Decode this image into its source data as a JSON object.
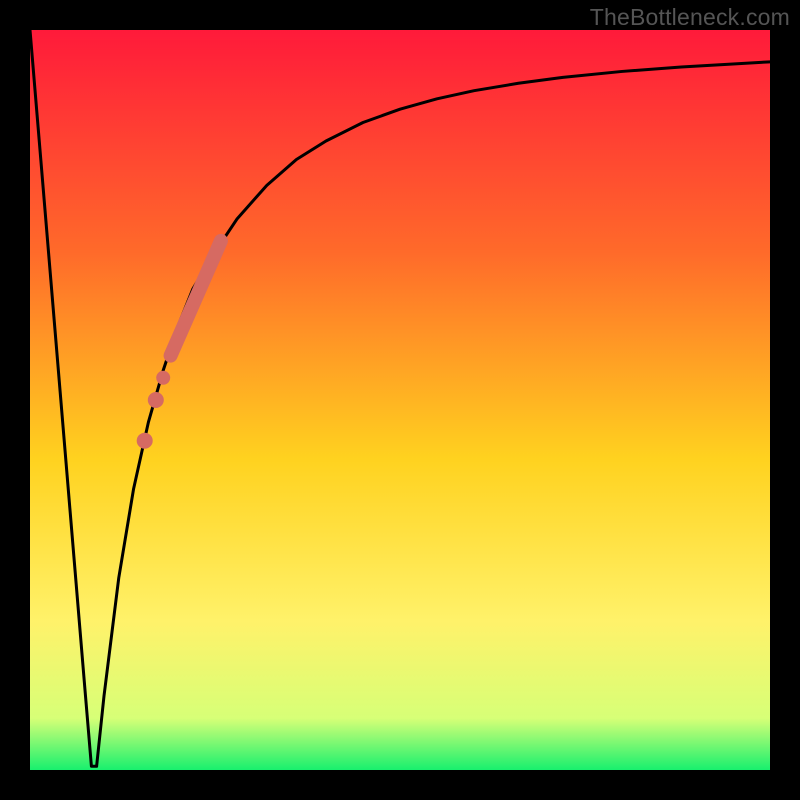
{
  "watermark": "TheBottleneck.com",
  "colors": {
    "frame": "#000000",
    "gradient_top": "#ff1a3a",
    "gradient_upper": "#ff6a2a",
    "gradient_mid": "#ffd21f",
    "gradient_lower": "#fff26a",
    "gradient_band": "#d7ff77",
    "gradient_bottom": "#18f06e",
    "curve": "#000000",
    "dot_fill": "#d66a62",
    "dot_stroke": "#b34f49"
  },
  "chart_data": {
    "type": "line",
    "title": "",
    "xlabel": "",
    "ylabel": "",
    "xlim": [
      0,
      100
    ],
    "ylim": [
      0,
      100
    ],
    "curve": {
      "x": [
        0,
        2,
        4,
        6,
        7.5,
        8.3,
        9,
        10,
        12,
        14,
        16,
        18,
        20,
        22,
        25,
        28,
        32,
        36,
        40,
        45,
        50,
        55,
        60,
        66,
        72,
        80,
        88,
        95,
        100
      ],
      "y": [
        100,
        76,
        52,
        28,
        10,
        0.5,
        0.5,
        10,
        26,
        38,
        47,
        54,
        60,
        65,
        70,
        74.5,
        79,
        82.5,
        85,
        87.5,
        89.3,
        90.7,
        91.8,
        92.8,
        93.6,
        94.4,
        95.0,
        95.4,
        95.7
      ]
    },
    "strip": {
      "start": {
        "x": 19,
        "y": 56
      },
      "end": {
        "x": 25.8,
        "y": 71.5
      },
      "width": 14
    },
    "dots": [
      {
        "x": 17.0,
        "y": 50.0,
        "r": 8
      },
      {
        "x": 18.0,
        "y": 53.0,
        "r": 7
      },
      {
        "x": 15.5,
        "y": 44.5,
        "r": 8
      }
    ]
  }
}
